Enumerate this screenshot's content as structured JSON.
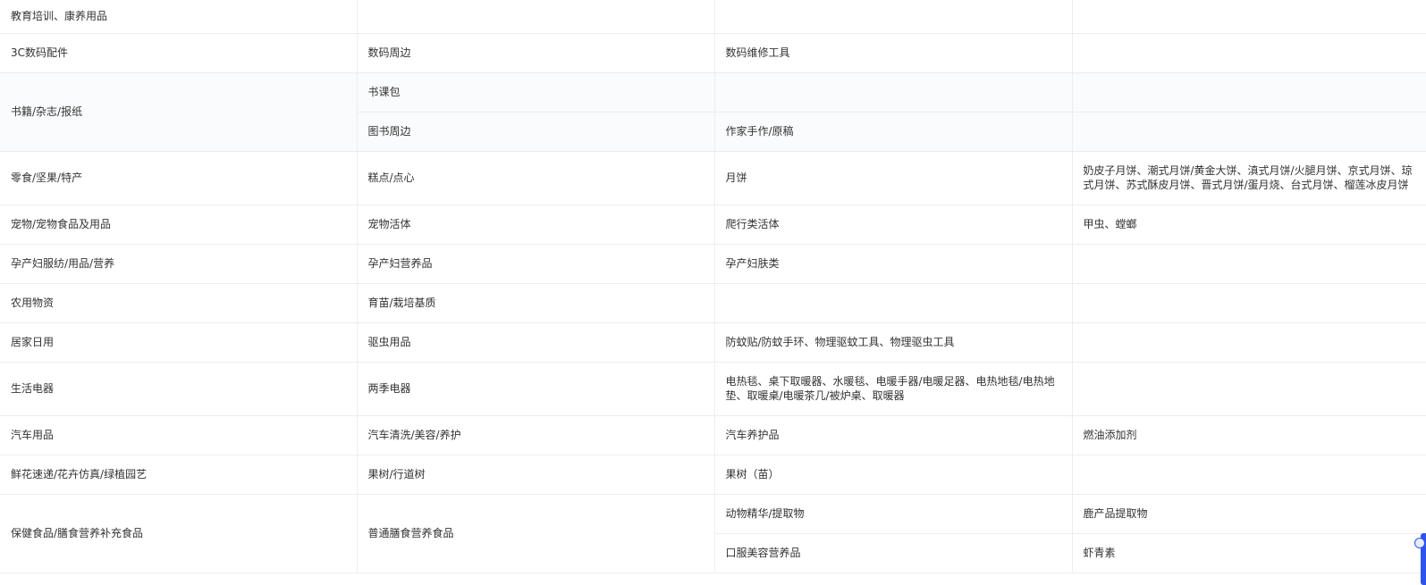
{
  "table": {
    "rows": [
      [
        "教育培训、康养用品",
        "",
        "",
        ""
      ],
      [
        "3C数码配件",
        "数码周边",
        "数码维修工具",
        ""
      ],
      [
        "书籍/杂志/报纸",
        "书课包",
        "",
        ""
      ],
      [
        "图书周边",
        "作家手作/原稿",
        ""
      ],
      [
        "零食/坚果/特产",
        "糕点/点心",
        "月饼",
        "奶皮子月饼、潮式月饼/黄金大饼、滇式月饼/火腿月饼、京式月饼、琼式月饼、苏式酥皮月饼、晋式月饼/蛋月烧、台式月饼、榴莲冰皮月饼"
      ],
      [
        "宠物/宠物食品及用品",
        "宠物活体",
        "爬行类活体",
        "甲虫、螳螂"
      ],
      [
        "孕产妇服纺/用品/营养",
        "孕产妇营养品",
        "孕产妇肤类",
        ""
      ],
      [
        "农用物资",
        "育苗/栽培基质",
        "",
        ""
      ],
      [
        "居家日用",
        "驱虫用品",
        "防蚊贴/防蚊手环、物理驱蚊工具、物理驱虫工具",
        ""
      ],
      [
        "生活电器",
        "两季电器",
        "电热毯、桌下取暖器、水暖毯、电暖手器/电暖足器、电热地毯/电热地垫、取暖桌/电暖茶几/被炉桌、取暖器",
        ""
      ],
      [
        "汽车用品",
        "汽车清洗/美容/养护",
        "汽车养护品",
        "燃油添加剂"
      ],
      [
        "鲜花速递/花卉仿真/绿植园艺",
        "果树/行道树",
        "果树（苗）",
        ""
      ],
      [
        "保健食品/膳食营养补充食品",
        "普通膳食营养食品",
        "动物精华/提取物",
        "鹿产品提取物"
      ],
      [
        "口服美容营养品",
        "虾青素"
      ]
    ]
  }
}
